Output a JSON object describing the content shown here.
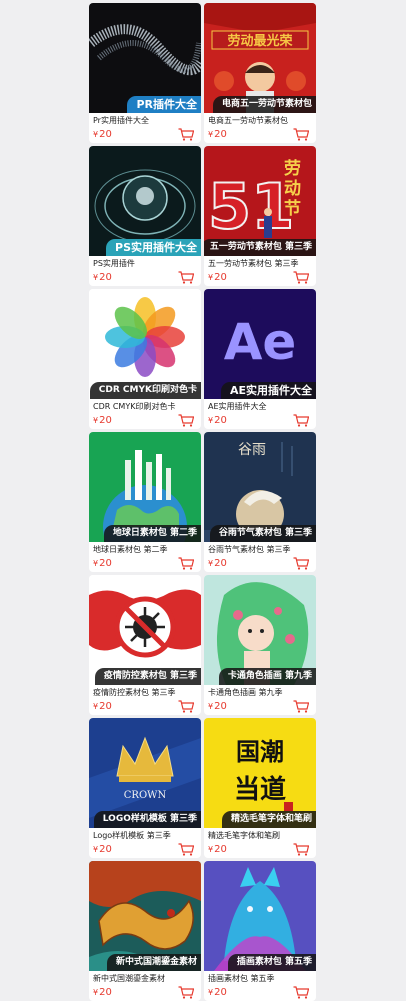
{
  "currency_symbol": "¥",
  "colors": {
    "price": "#e63a2f",
    "cart": "#e63a2f",
    "badge_bg": "#141414"
  },
  "cards": [
    {
      "badge": "PR插件大全",
      "title": "Pr实用插件大全",
      "price": "20"
    },
    {
      "badge": "电商五一劳动节素材包",
      "title": "电商五一劳动节素材包",
      "price": "20",
      "thumb_text": "劳动最光荣"
    },
    {
      "badge": "PS实用插件大全",
      "title": "PS实用插件",
      "price": "20"
    },
    {
      "badge": "五一劳动节素材包 第三季",
      "title": "五一劳动节素材包 第三季",
      "price": "20",
      "thumb_text": "劳动节"
    },
    {
      "badge": "CDR CMYK印刷对色卡",
      "title": "CDR CMYK印刷对色卡",
      "price": "20"
    },
    {
      "badge": "AE实用插件大全",
      "title": "AE实用插件大全",
      "price": "20",
      "thumb_text": "Ae"
    },
    {
      "badge": "地球日素材包 第二季",
      "title": "地球日素材包 第二季",
      "price": "20"
    },
    {
      "badge": "谷雨节气素材包 第三季",
      "title": "谷雨节气素材包 第三季",
      "price": "20",
      "thumb_text": "谷雨"
    },
    {
      "badge": "疫情防控素材包 第三季",
      "title": "疫情防控素材包 第三季",
      "price": "20"
    },
    {
      "badge": "卡通角色插画 第九季",
      "title": "卡通角色插画 第九季",
      "price": "20"
    },
    {
      "badge": "LOGO样机模板 第三季",
      "title": "Logo样机模板 第三季",
      "price": "20",
      "thumb_text": "CROWN"
    },
    {
      "badge": "精选毛笔字体和笔刷",
      "title": "精选毛笔字体和笔刷",
      "price": "20",
      "thumb_text": "国潮当道"
    },
    {
      "badge": "新中式国潮鎏金素材",
      "title": "新中式国潮鎏金素材",
      "price": "20"
    },
    {
      "badge": "插画素材包 第五季",
      "title": "插画素材包 第五季",
      "price": "20"
    }
  ]
}
